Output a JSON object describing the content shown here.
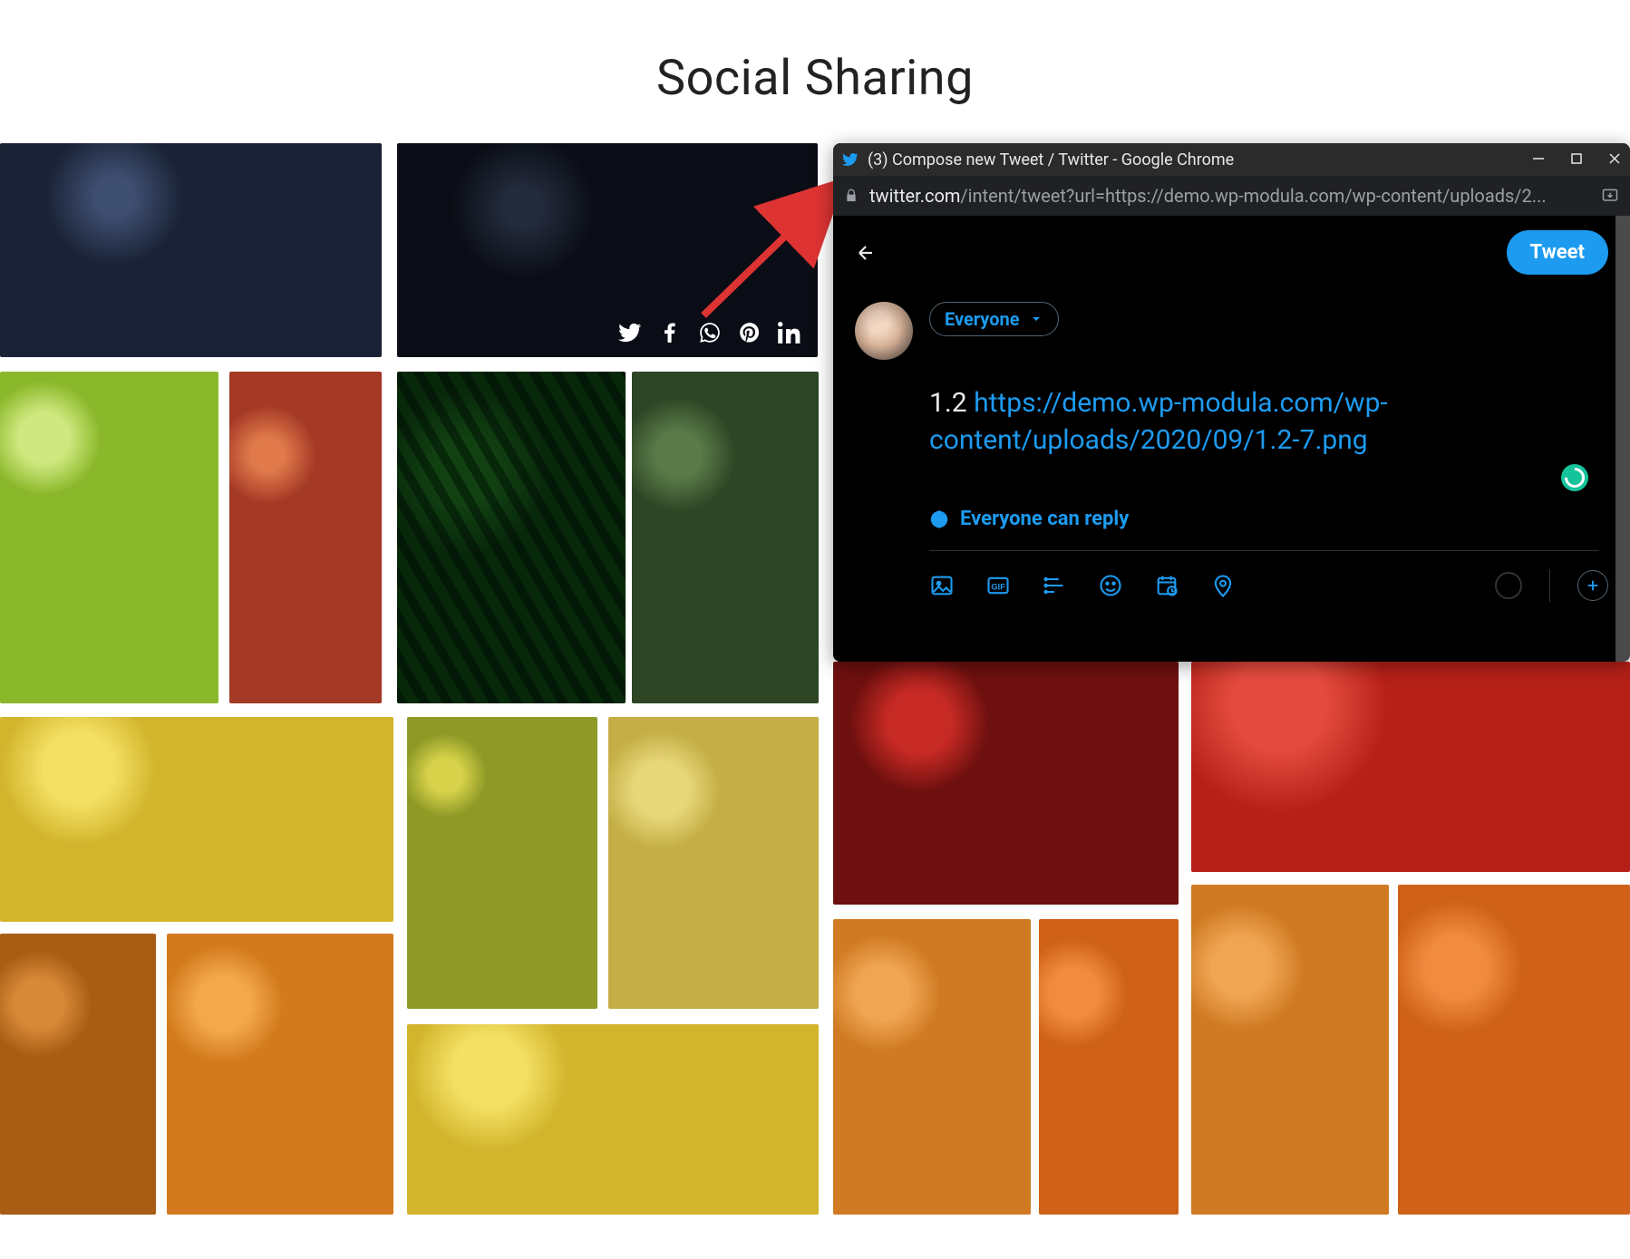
{
  "page": {
    "title": "Social Sharing"
  },
  "social_icons": {
    "twitter": "twitter-icon",
    "facebook": "facebook-icon",
    "whatsapp": "whatsapp-icon",
    "pinterest": "pinterest-icon",
    "linkedin": "linkedin-icon"
  },
  "popup": {
    "window_title": "(3) Compose new Tweet / Twitter - Google Chrome",
    "url_host": "twitter.com",
    "url_path": "/intent/tweet?url=https://demo.wp-modula.com/wp-content/uploads/2...",
    "back_label": "Back",
    "tweet_button": "Tweet",
    "audience_label": "Everyone",
    "compose_prefix": "1.2 ",
    "compose_link": "https://demo.wp-modula.com/wp-content/uploads/2020/09/1.2-7.png",
    "reply_label": "Everyone can reply",
    "tools": {
      "media": "image-icon",
      "gif": "gif-icon",
      "poll": "poll-icon",
      "emoji": "emoji-icon",
      "schedule": "schedule-icon",
      "location": "location-icon",
      "add_thread": "plus-icon"
    }
  }
}
